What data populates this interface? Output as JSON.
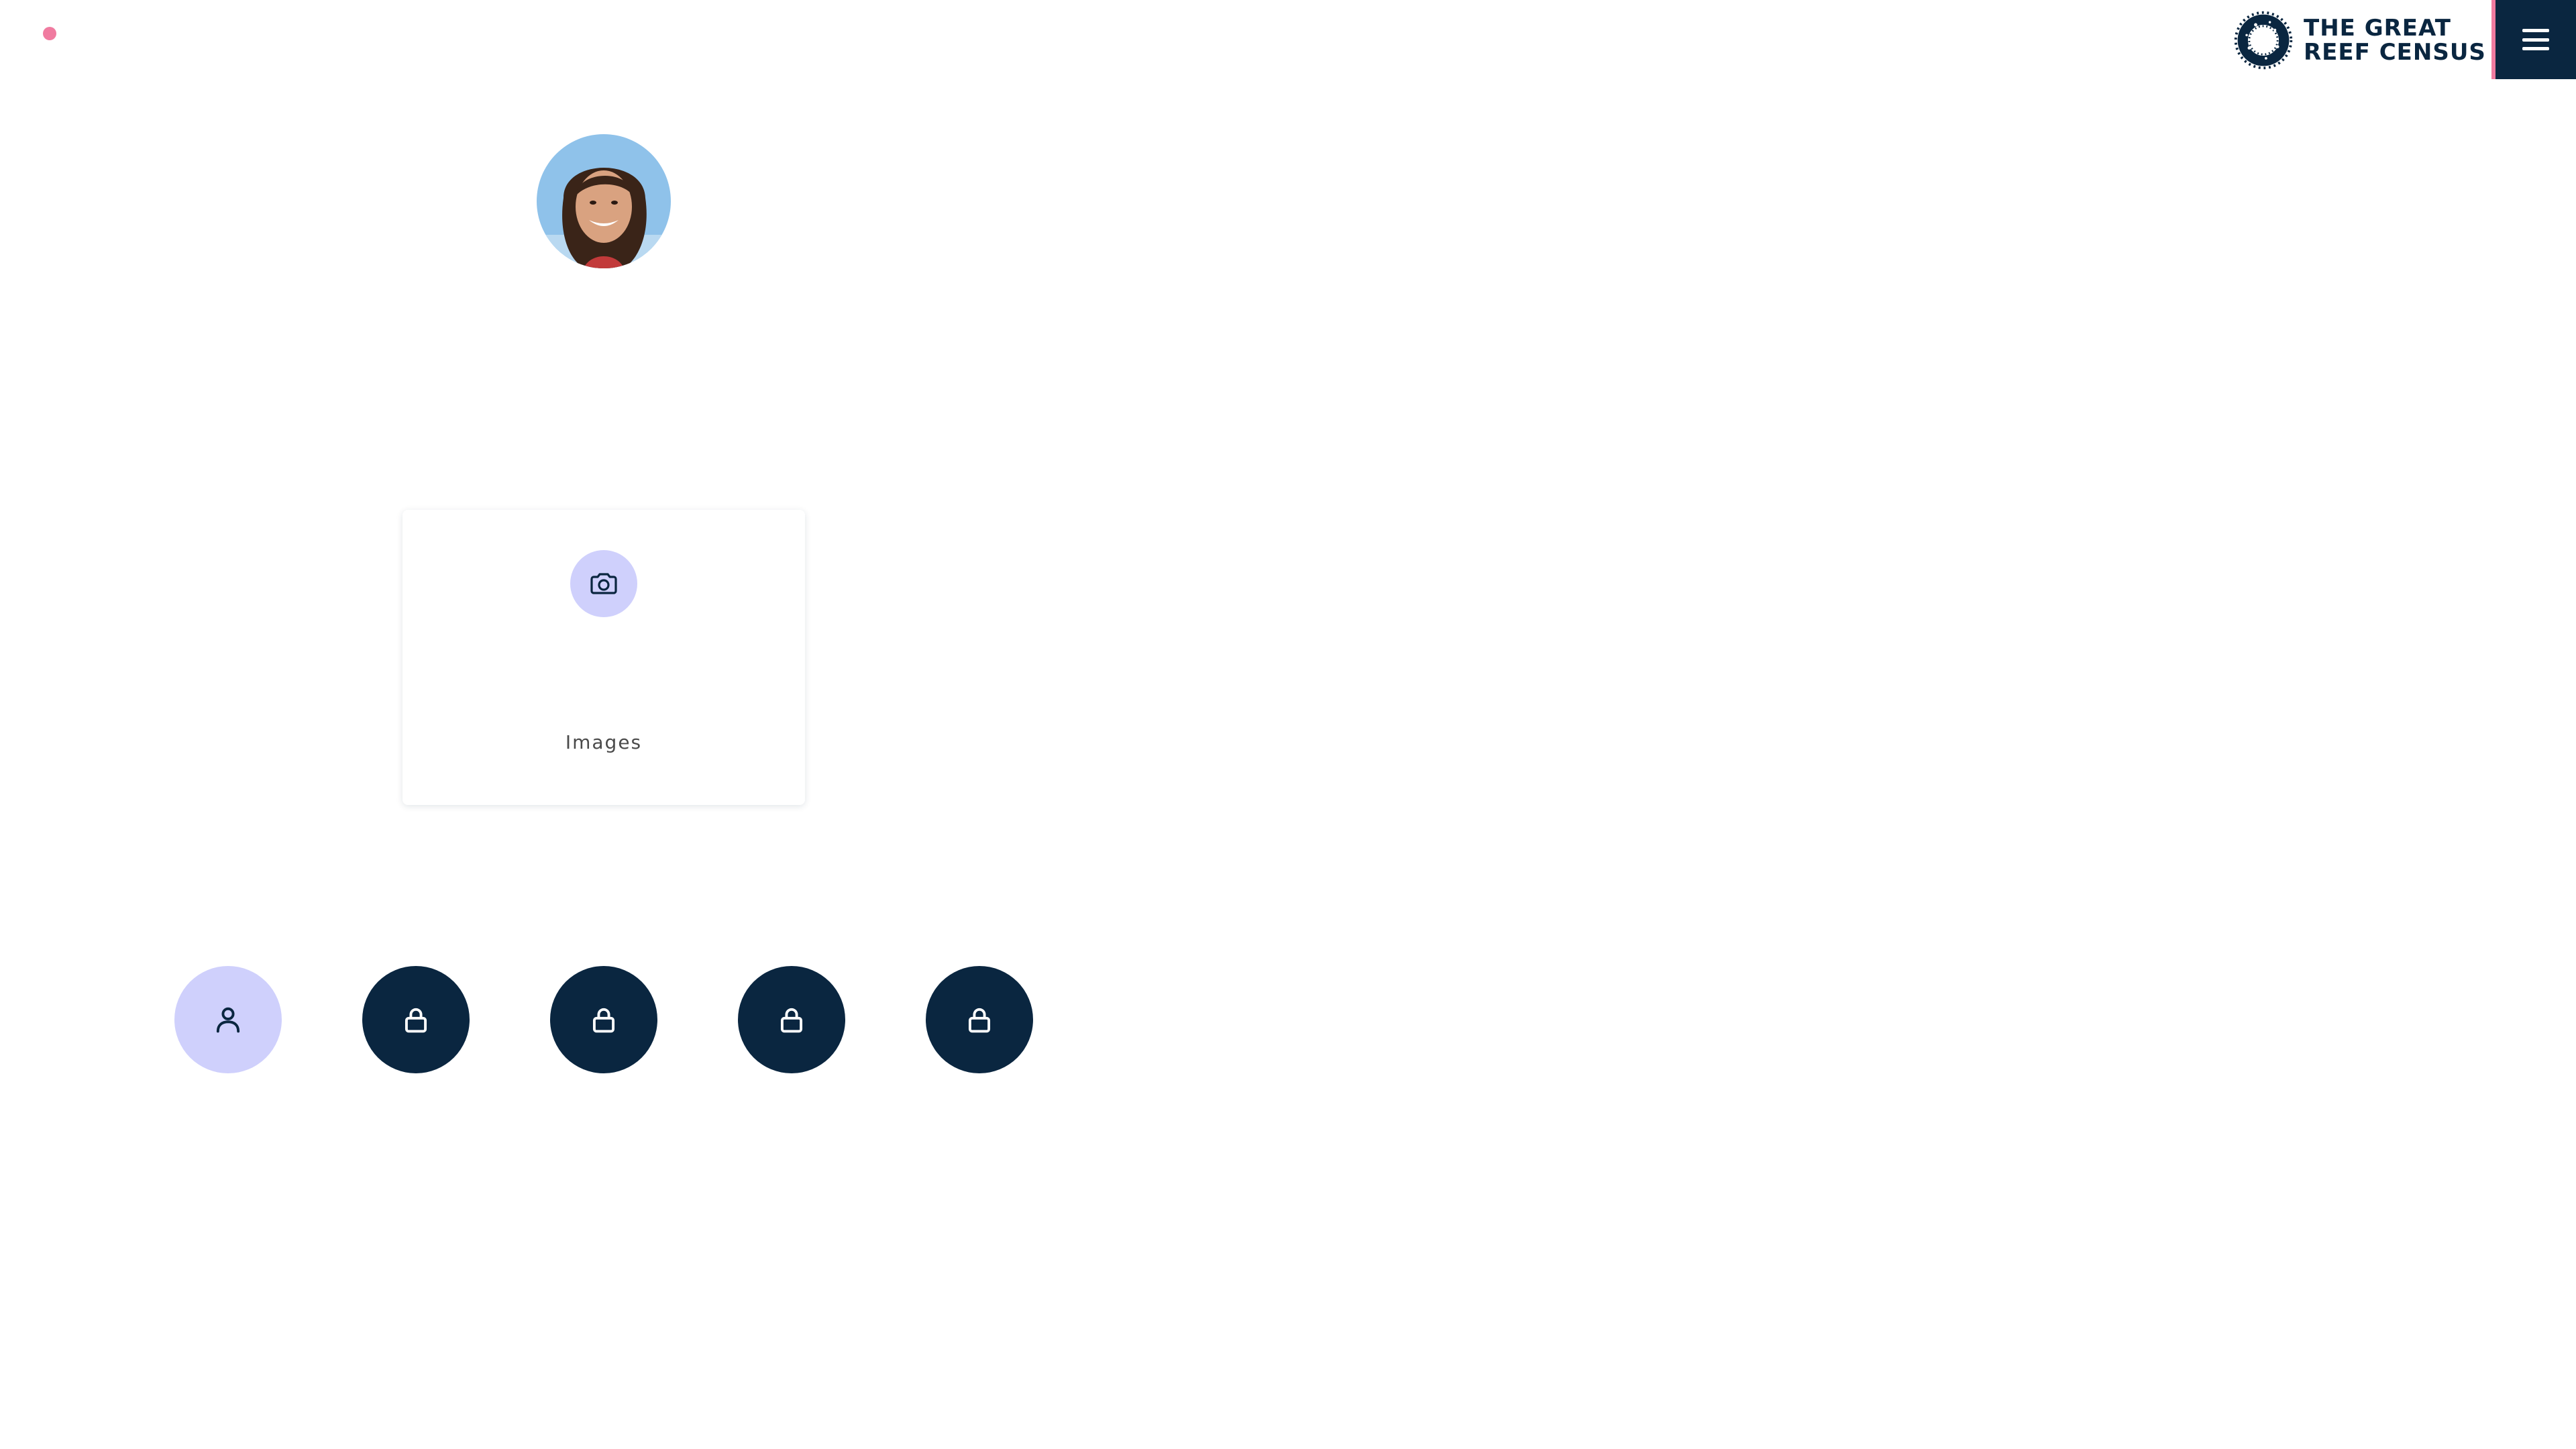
{
  "brand": {
    "logo_line1": "THE GREAT",
    "logo_line2": "REEF CENSUS",
    "logo_icon": "reef-ring-logo",
    "navy": "#0a2640",
    "pink": "#f07ba0",
    "lavender": "#cfd0fc"
  },
  "header": {
    "menu_icon": "hamburger-menu-icon"
  },
  "profile": {
    "avatar_icon": "user-avatar-photo"
  },
  "upload_card": {
    "icon": "camera-icon",
    "label": "Images"
  },
  "steps": [
    {
      "icon": "user-icon",
      "state": "active"
    },
    {
      "icon": "lock-icon",
      "state": "locked"
    },
    {
      "icon": "lock-icon",
      "state": "locked"
    },
    {
      "icon": "lock-icon",
      "state": "locked"
    },
    {
      "icon": "lock-icon",
      "state": "locked"
    }
  ]
}
